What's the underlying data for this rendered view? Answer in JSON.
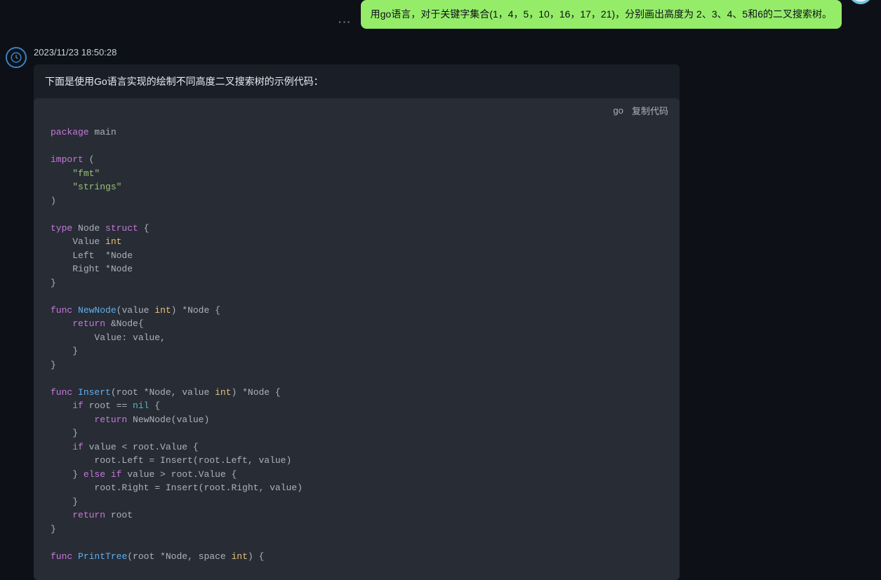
{
  "user_message": "用go语言，对于关键字集合(1，4，5，10，16，17，21)，分别画出高度为 2、3、4、5和6的二叉搜索树。",
  "timestamp": "2023/11/23 18:50:28",
  "intro": "下面是使用Go语言实现的绘制不同高度二叉搜索树的示例代码：",
  "code_lang": "go",
  "copy_label": "复制代码",
  "code": {
    "package_kw": "package",
    "package_name": " main",
    "import_kw": "import",
    "import_fmt": "\"fmt\"",
    "import_strings": "\"strings\"",
    "type_kw": "type",
    "node_name": " Node ",
    "struct_kw": "struct",
    "value_field": "Value ",
    "int_type": "int",
    "left_field": "Left  *Node",
    "right_field": "Right *Node",
    "func_kw": "func",
    "newnode_name": "NewNode",
    "newnode_params_open": "(",
    "newnode_param_value": "value ",
    "newnode_sig_rest": ") *Node {",
    "return_kw": "return",
    "newnode_body1": " &Node{",
    "newnode_body2": "Value: value,",
    "insert_name": "Insert",
    "insert_sig_rest1": "(root *Node, value ",
    "insert_sig_rest2": ") *Node {",
    "if_kw": "if",
    "insert_if1": " root == ",
    "nil_kw": "nil",
    "insert_if1_end": " {",
    "insert_ret_new": " NewNode(value)",
    "insert_if2": " value < root.Value {",
    "insert_left": "root.Left = Insert(root.Left, value)",
    "else_kw": "else",
    "insert_elseif": " value > root.Value {",
    "insert_right": "root.Right = Insert(root.Right, value)",
    "insert_ret_root": " root",
    "printtree_name": "PrintTree",
    "printtree_sig1": "(root *Node, space ",
    "printtree_sig2": ") {"
  }
}
